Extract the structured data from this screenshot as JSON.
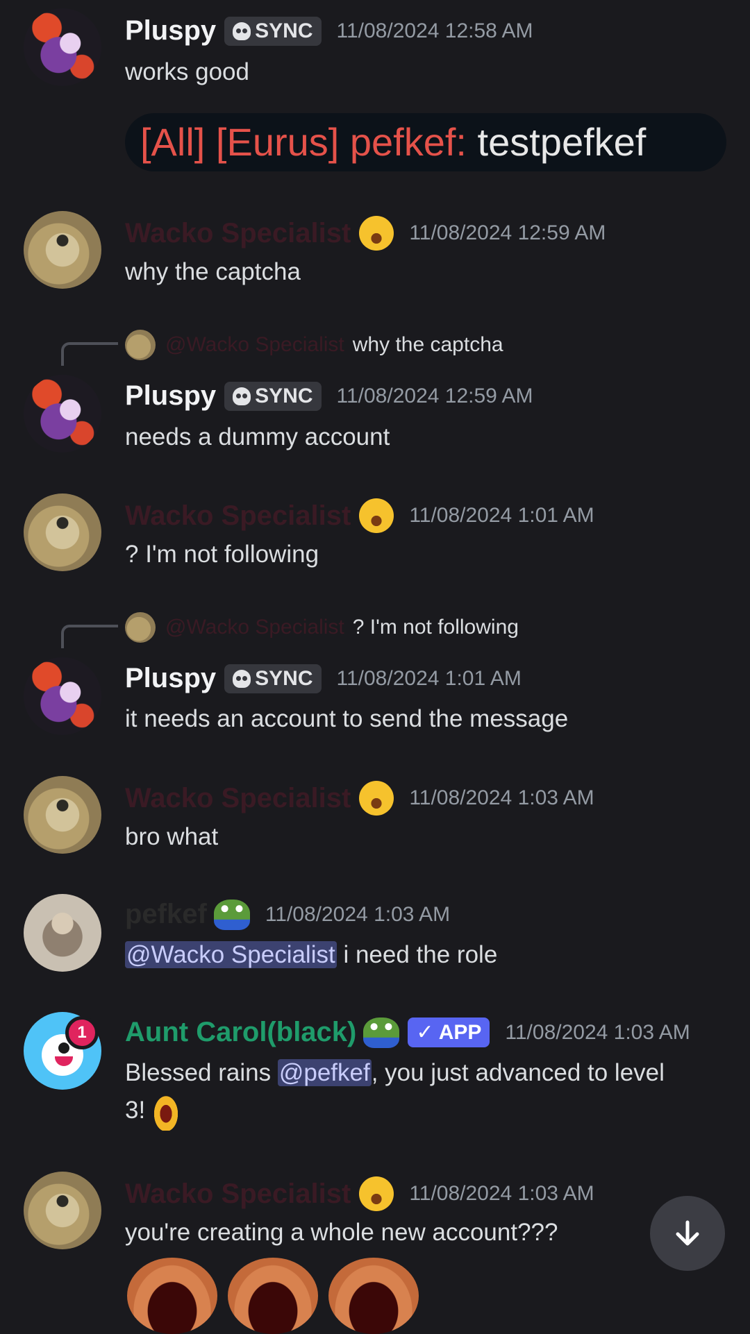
{
  "messages": [
    {
      "author": "Pluspy",
      "tag": "SYNC",
      "time": "11/08/2024 12:58 AM",
      "text": "works good",
      "embed": {
        "prefix": "[All] [Eurus] pefkef:",
        "body": "testpefkef"
      }
    },
    {
      "author": "Wacko Specialist",
      "time": "11/08/2024 12:59 AM",
      "text": "why the captcha"
    },
    {
      "reply": {
        "mention": "@Wacko Specialist",
        "text": "why the captcha"
      },
      "author": "Pluspy",
      "tag": "SYNC",
      "time": "11/08/2024 12:59 AM",
      "text": "needs a dummy account"
    },
    {
      "author": "Wacko Specialist",
      "time": "11/08/2024 1:01 AM",
      "text": "? I'm not following"
    },
    {
      "reply": {
        "mention": "@Wacko Specialist",
        "text": "? I'm not following"
      },
      "author": "Pluspy",
      "tag": "SYNC",
      "time": "11/08/2024 1:01 AM",
      "text": "it needs an account to send the message"
    },
    {
      "author": "Wacko Specialist",
      "time": "11/08/2024 1:03 AM",
      "text": "bro what"
    },
    {
      "author": "pefkef",
      "time": "11/08/2024 1:03 AM",
      "mention": "@Wacko Specialist",
      "text": "i need the role"
    },
    {
      "author": "Aunt Carol(black)",
      "app_tag": "✓ APP",
      "badge": "1",
      "time": "11/08/2024 1:03 AM",
      "text_pre": "Blessed rains ",
      "mention": "@pefkef",
      "text_post": ", you just advanced to level",
      "text_line2": "3!"
    },
    {
      "author": "Wacko Specialist",
      "time": "11/08/2024 1:03 AM",
      "text": "you're creating a whole new account???"
    }
  ],
  "icons": {
    "scroll": "arrow-down-icon",
    "tag": "skull-icon",
    "reaction": "rofl-emoji",
    "frog": "pepe-emoji"
  },
  "colors": {
    "background": "#1a1a1e",
    "mention_bg": "#3c4270",
    "app_tag": "#5865f2",
    "carol_name": "#1f9c6b"
  }
}
